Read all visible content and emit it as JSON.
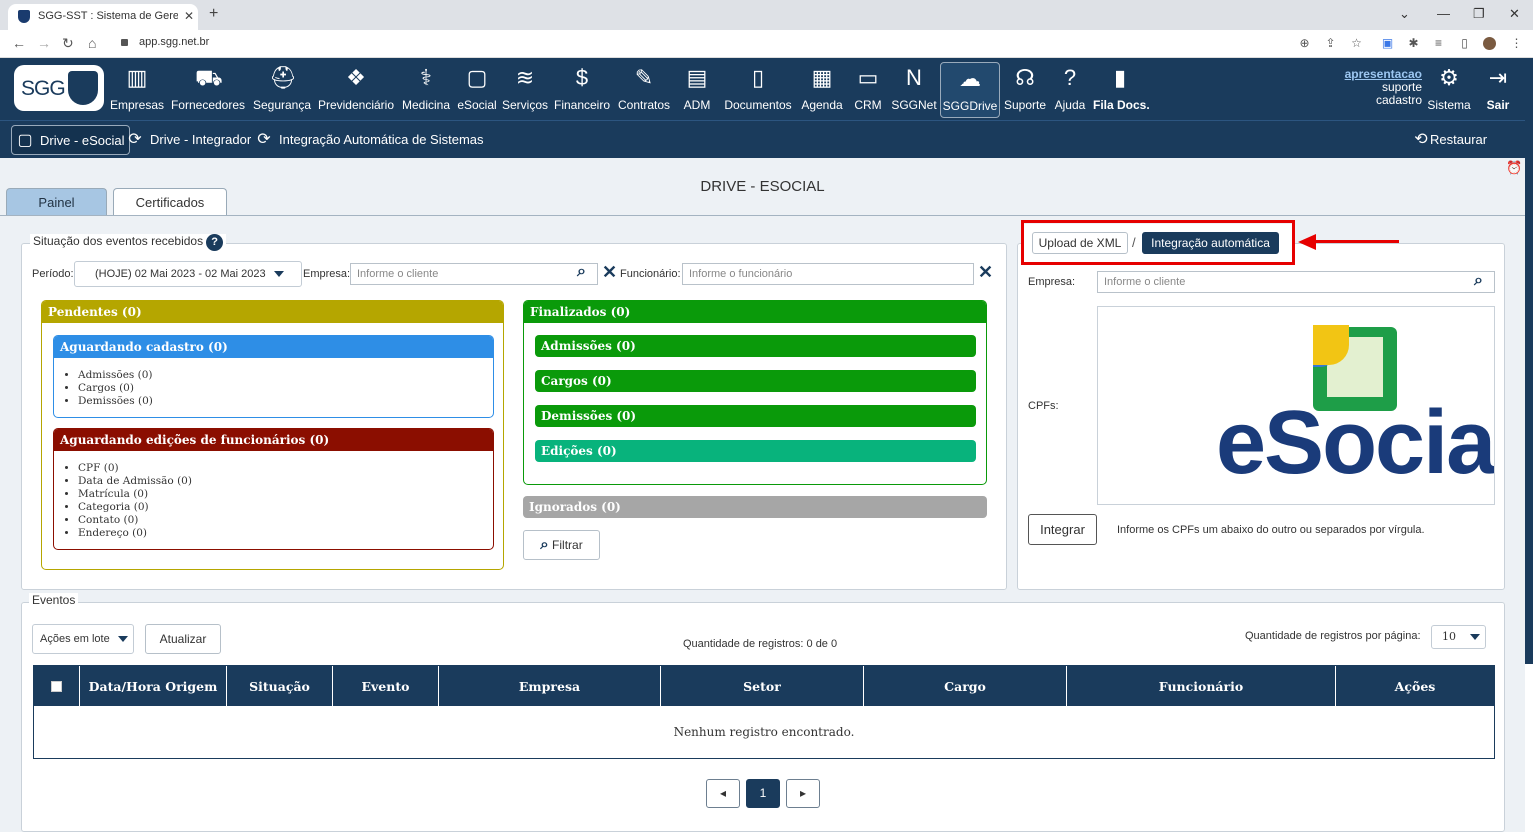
{
  "browser": {
    "tab_title": "SGG-SST : Sistema de Gerenciam",
    "url": "app.sgg.net.br"
  },
  "header": {
    "logo_text": "SGG",
    "modules": [
      {
        "label": "Empresas",
        "icon": "building-icon"
      },
      {
        "label": "Fornecedores",
        "icon": "truck-icon"
      },
      {
        "label": "Segurança",
        "icon": "helmet-icon"
      },
      {
        "label": "Previdenciário",
        "icon": "handshake-icon"
      },
      {
        "label": "Medicina",
        "icon": "stethoscope-icon"
      },
      {
        "label": "eSocial",
        "icon": "esocial-icon"
      },
      {
        "label": "Serviços",
        "icon": "layers-icon"
      },
      {
        "label": "Financeiro",
        "icon": "money-bag-icon"
      },
      {
        "label": "Contratos",
        "icon": "contract-icon"
      },
      {
        "label": "ADM",
        "icon": "briefcase-icon"
      },
      {
        "label": "Documentos",
        "icon": "document-icon"
      },
      {
        "label": "Agenda",
        "icon": "calendar-icon"
      },
      {
        "label": "CRM",
        "icon": "crm-icon"
      },
      {
        "label": "SGGNet",
        "icon": "net-icon"
      },
      {
        "label": "SGGDrive",
        "icon": "cloud-drive-icon"
      },
      {
        "label": "Suporte",
        "icon": "headset-icon"
      },
      {
        "label": "Ajuda",
        "icon": "help-bubble-icon"
      },
      {
        "label": "Fila Docs.",
        "icon": "doc-queue-icon"
      }
    ],
    "user_login": "apresentacao",
    "user_line2": "suporte",
    "user_line3": "cadastro",
    "sistema_label": "Sistema",
    "sair_label": "Sair"
  },
  "subbar": {
    "items": [
      "Drive - eSocial",
      "Drive - Integrador",
      "Integração Automática de Sistemas"
    ],
    "restore_label": "Restaurar"
  },
  "page": {
    "title": "DRIVE - ESOCIAL",
    "tabs": [
      "Painel",
      "Certificados"
    ]
  },
  "situacao": {
    "legend": "Situação dos eventos recebidos",
    "help": "?",
    "periodo_label": "Período:",
    "periodo_value": "(HOJE) 02 Mai 2023 - 02 Mai 2023",
    "empresa_label": "Empresa:",
    "empresa_placeholder": "Informe o cliente",
    "funcionario_label": "Funcionário:",
    "funcionario_placeholder": "Informe o funcionário",
    "pendentes": "Pendentes (0)",
    "aguardando_cadastro": "Aguardando cadastro (0)",
    "cadastro_items": [
      "Admissões (0)",
      "Cargos (0)",
      "Demissões (0)"
    ],
    "aguardando_edicoes": "Aguardando edições de funcionários (0)",
    "edicoes_items": [
      "CPF (0)",
      "Data de Admissão (0)",
      "Matrícula (0)",
      "Categoria (0)",
      "Contato (0)",
      "Endereço (0)"
    ],
    "finalizados": "Finalizados (0)",
    "finalizados_items": [
      "Admissões (0)",
      "Cargos (0)",
      "Demissões (0)",
      "Edições (0)"
    ],
    "ignorados": "Ignorados (0)",
    "filtrar": "Filtrar"
  },
  "integracao": {
    "upload_xml": "Upload de XML",
    "separator": "/",
    "integracao_auto": "Integração automática",
    "empresa_label": "Empresa:",
    "empresa_placeholder": "Informe o cliente",
    "cpfs_label": "CPFs:",
    "logo_text": "eSocial",
    "integrar": "Integrar",
    "hint": "Informe os CPFs um abaixo do outro ou separados por vírgula."
  },
  "eventos": {
    "legend": "Eventos",
    "acoes_lote": "Ações em lote",
    "atualizar": "Atualizar",
    "qtd_registros": "Quantidade de registros: 0 de 0",
    "qtd_por_pagina_label": "Quantidade de registros por página:",
    "qtd_por_pagina_value": "10",
    "columns": [
      "Data/Hora Origem",
      "Situação",
      "Evento",
      "Empresa",
      "Setor",
      "Cargo",
      "Funcionário",
      "Ações"
    ],
    "empty": "Nenhum registro encontrado.",
    "page": "1"
  },
  "colors": {
    "navy": "#1a3b5c",
    "pendentes": "#b5a600",
    "cadastro": "#2e8ee6",
    "edicoes": "#8b0e00",
    "finalizados": "#0a9a0a",
    "edicoes_final": "#08b37c",
    "ignorados": "#a6a6a6",
    "annotation": "#e60000"
  }
}
